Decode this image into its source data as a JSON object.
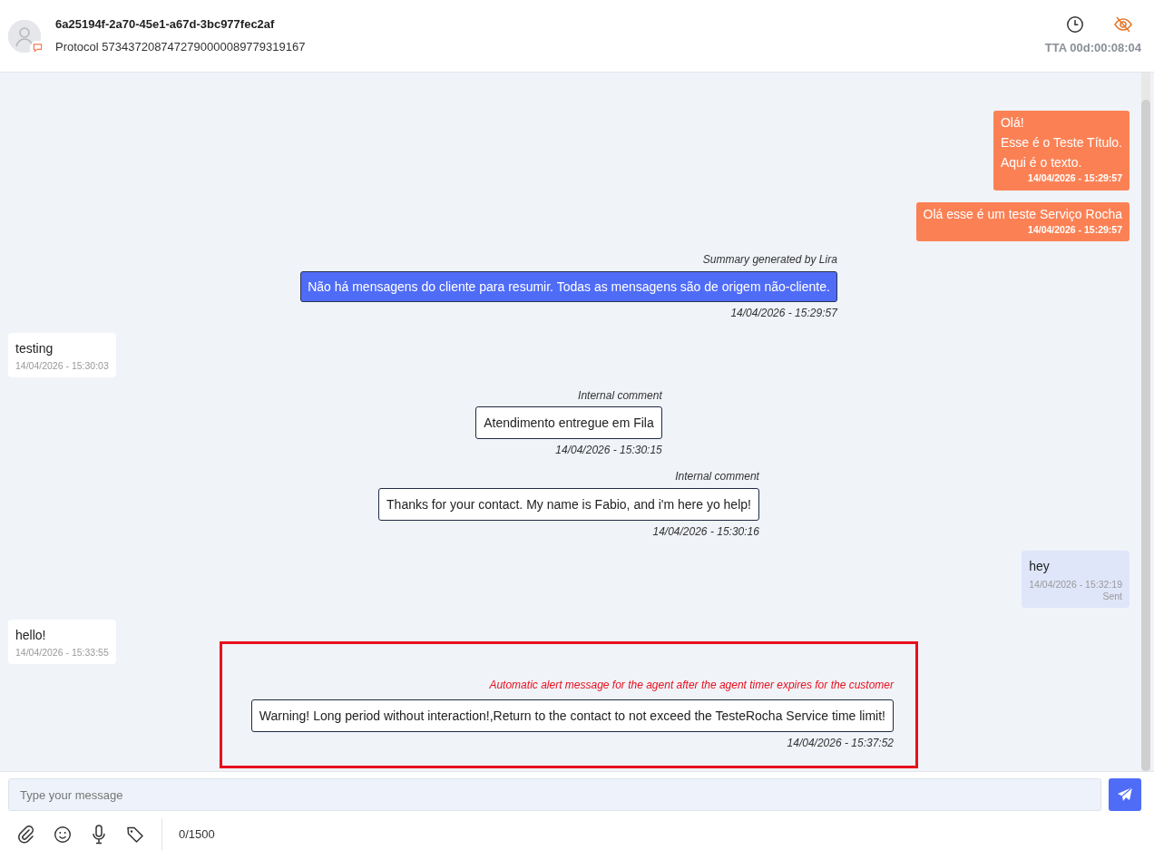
{
  "header": {
    "title": "6a25194f-2a70-45e1-a67d-3bc977fec2af",
    "protocol": "Protocol 5734372087472790000089779319167",
    "timer": "TTA 00d:00:08:04"
  },
  "messages": [
    {
      "kind": "template",
      "lines": [
        "Olá!",
        "Esse é o Teste Título.",
        "Aqui é o texto."
      ],
      "time": "14/04/2026 - 15:29:57"
    },
    {
      "kind": "template",
      "lines": [
        "Olá esse é um teste Serviço Rocha"
      ],
      "time": "14/04/2026 - 15:29:57"
    },
    {
      "kind": "summary",
      "label": "Summary generated by Lira",
      "text": "Não há mensagens do cliente para resumir. Todas as mensagens são de origem não-cliente.",
      "time": "14/04/2026 - 15:29:57"
    },
    {
      "kind": "customer",
      "text": "testing",
      "time": "14/04/2026 - 15:30:03"
    },
    {
      "kind": "internal",
      "label": "Internal comment",
      "text": "Atendimento entregue em Fila",
      "time": "14/04/2026 - 15:30:15"
    },
    {
      "kind": "internal",
      "label": "Internal comment",
      "text": "Thanks for your contact. My name is Fabio, and i'm here yo help!",
      "time": "14/04/2026 - 15:30:16"
    },
    {
      "kind": "agent",
      "text": "hey",
      "time": "14/04/2026 - 15:32:19",
      "status": "Sent"
    },
    {
      "kind": "customer",
      "text": "hello!",
      "time": "14/04/2026 - 15:33:55"
    },
    {
      "kind": "alert",
      "label": "Automatic alert message for the agent after the agent timer expires for the customer",
      "text": "Warning! Long period without interaction!,Return to the contact to not exceed the TesteRocha Service time limit!",
      "time": "14/04/2026 - 15:37:52"
    }
  ],
  "composer": {
    "placeholder": "Type your message",
    "counter": "0/1500"
  }
}
